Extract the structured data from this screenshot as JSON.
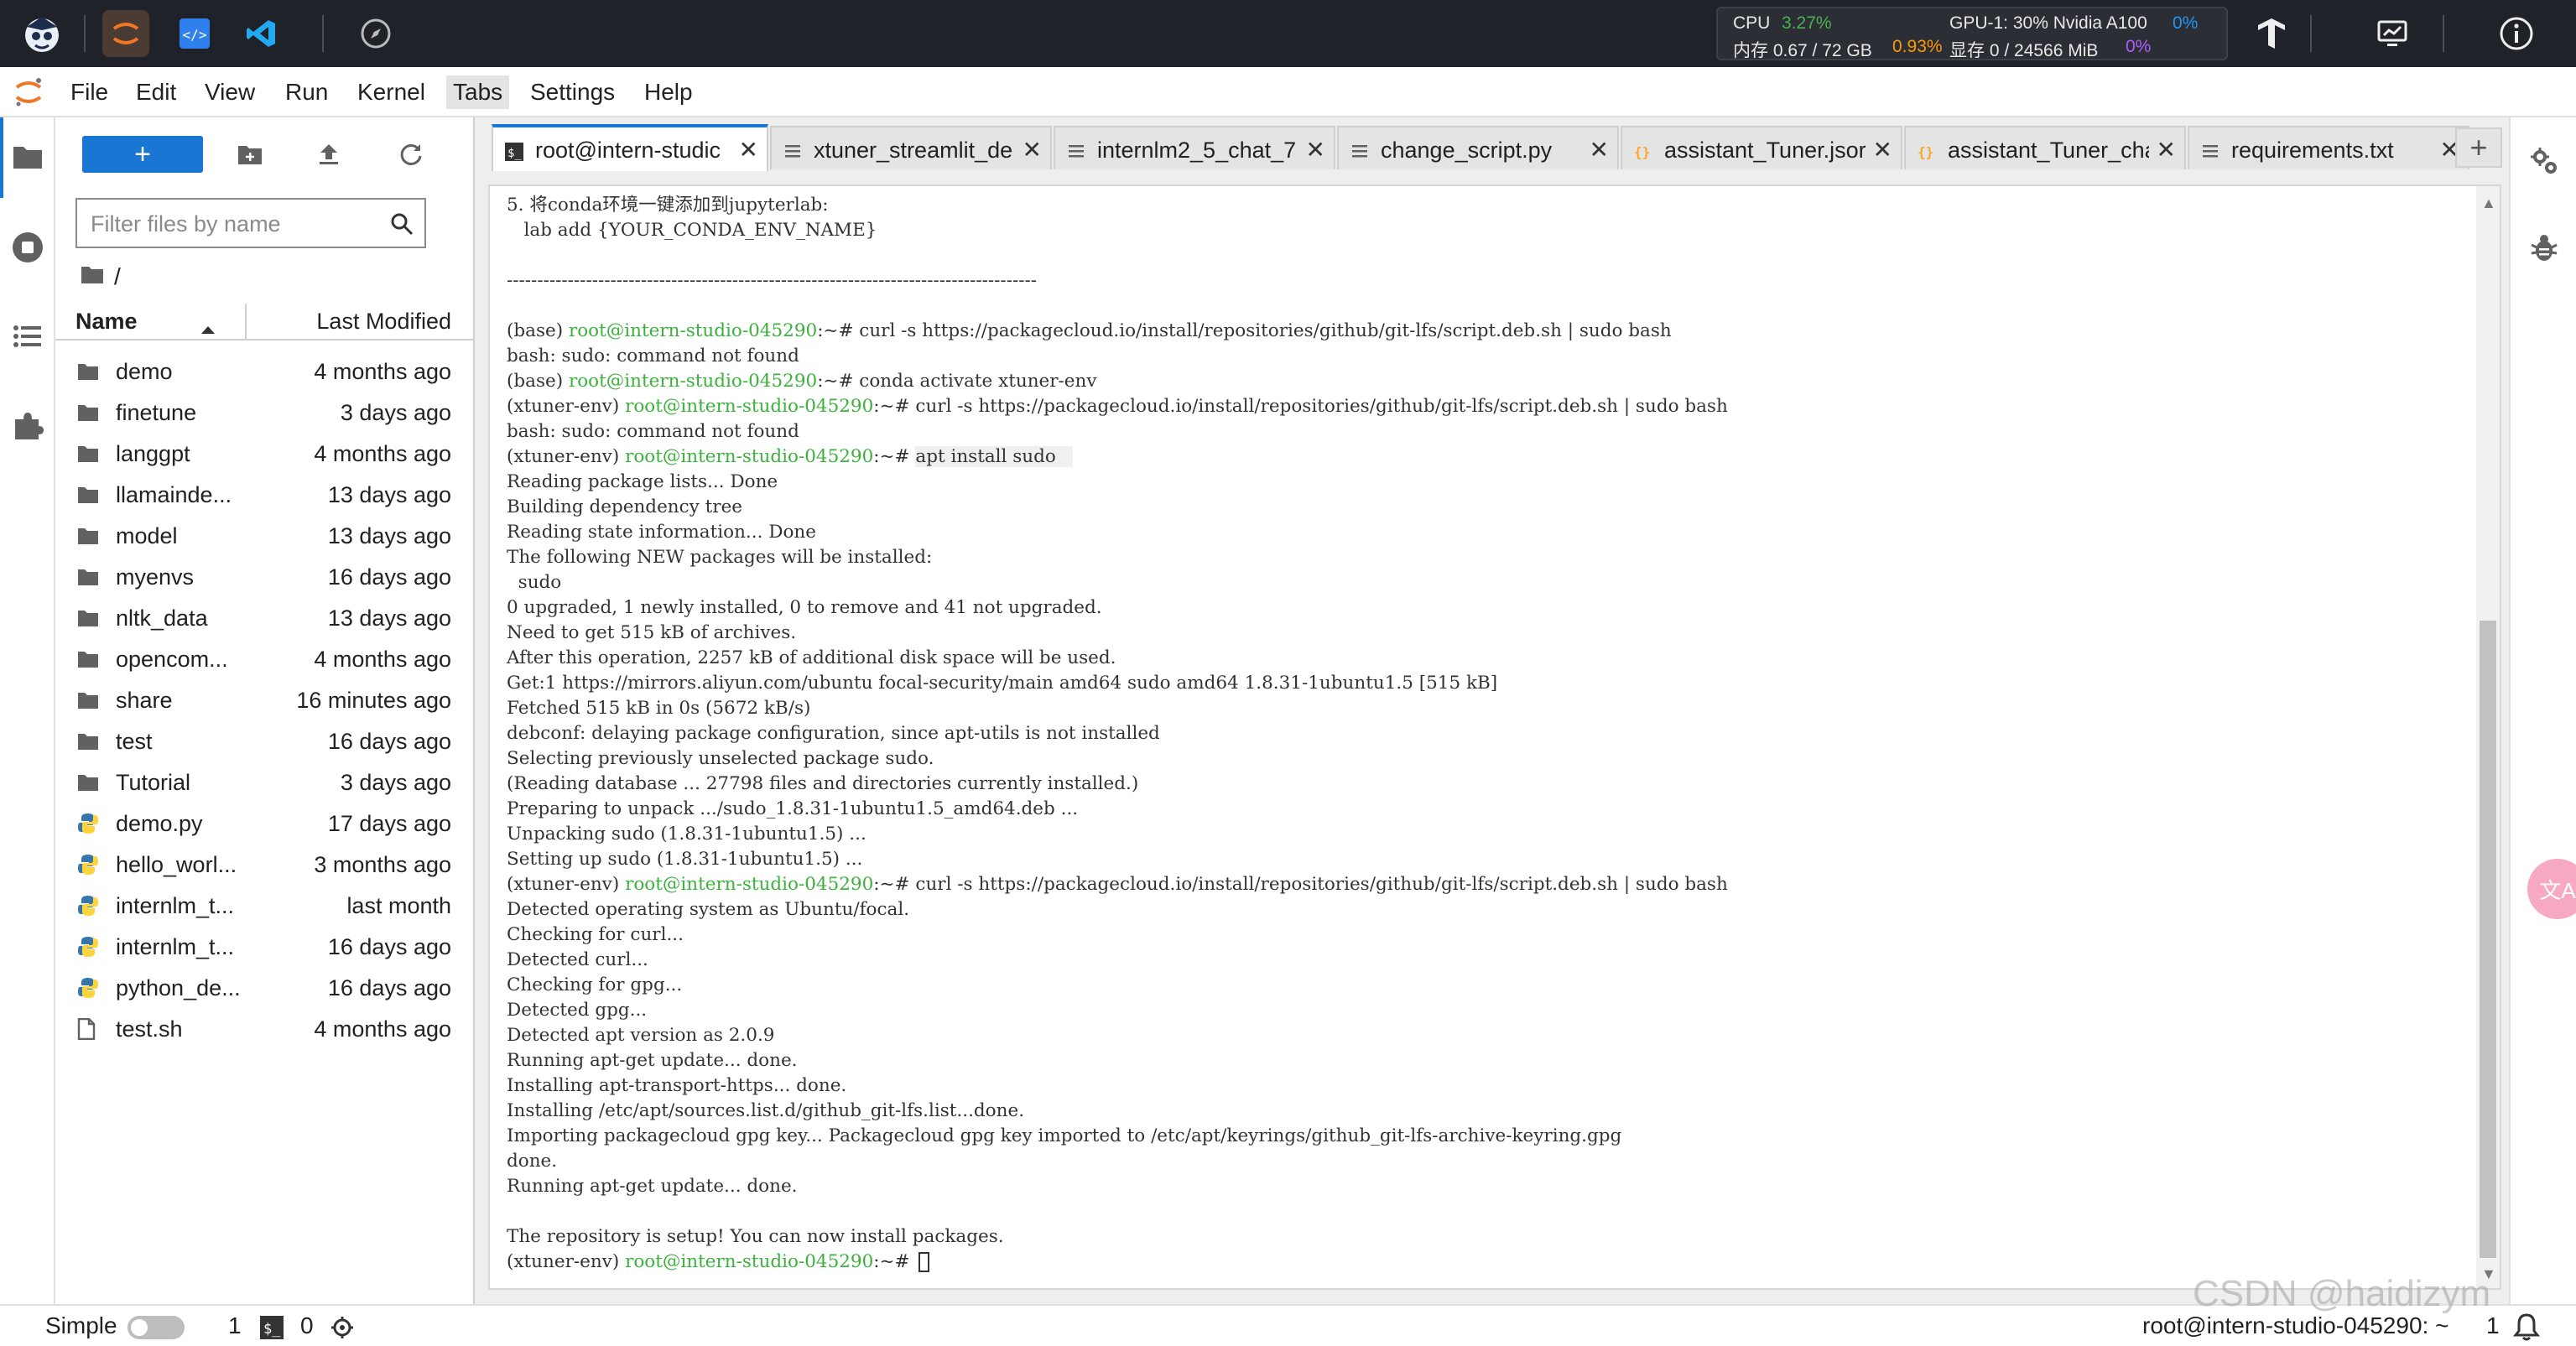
{
  "topbar": {
    "stats": {
      "cpu_label": "CPU",
      "cpu_value": "3.27%",
      "gpu_label": "GPU-1: 30% Nvidia A100",
      "gpu_value": "0%",
      "mem_label": "内存 0.67 / 72 GB",
      "mem_value": "0.93%",
      "vram_label": "显存 0 / 24566 MiB",
      "vram_value": "0%"
    },
    "icons": [
      "intern-logo-icon",
      "jupyter-icon",
      "code-editor-icon",
      "vscode-icon",
      "compass-icon",
      "tensorflow-icon",
      "monitor-icon",
      "info-icon"
    ]
  },
  "menu": [
    "File",
    "Edit",
    "View",
    "Run",
    "Kernel",
    "Tabs",
    "Settings",
    "Help"
  ],
  "menu_active": "Tabs",
  "filebrowser": {
    "new_label": "+",
    "filter_placeholder": "Filter files by name",
    "breadcrumb": "/",
    "col_name": "Name",
    "col_modified": "Last Modified",
    "files": [
      {
        "name": "demo",
        "modified": "4 months ago",
        "type": "folder"
      },
      {
        "name": "finetune",
        "modified": "3 days ago",
        "type": "folder"
      },
      {
        "name": "langgpt",
        "modified": "4 months ago",
        "type": "folder"
      },
      {
        "name": "llamainde...",
        "modified": "13 days ago",
        "type": "folder"
      },
      {
        "name": "model",
        "modified": "13 days ago",
        "type": "folder"
      },
      {
        "name": "myenvs",
        "modified": "16 days ago",
        "type": "folder"
      },
      {
        "name": "nltk_data",
        "modified": "13 days ago",
        "type": "folder"
      },
      {
        "name": "opencom...",
        "modified": "4 months ago",
        "type": "folder"
      },
      {
        "name": "share",
        "modified": "16 minutes ago",
        "type": "folder"
      },
      {
        "name": "test",
        "modified": "16 days ago",
        "type": "folder"
      },
      {
        "name": "Tutorial",
        "modified": "3 days ago",
        "type": "folder"
      },
      {
        "name": "demo.py",
        "modified": "17 days ago",
        "type": "python"
      },
      {
        "name": "hello_worl...",
        "modified": "3 months ago",
        "type": "python"
      },
      {
        "name": "internlm_t...",
        "modified": "last month",
        "type": "python"
      },
      {
        "name": "internlm_t...",
        "modified": "16 days ago",
        "type": "python"
      },
      {
        "name": "python_de...",
        "modified": "16 days ago",
        "type": "python"
      },
      {
        "name": "test.sh",
        "modified": "4 months ago",
        "type": "file"
      }
    ]
  },
  "tabs": [
    {
      "label": "root@intern-studic",
      "type": "terminal",
      "active": true
    },
    {
      "label": "xtuner_streamlit_de",
      "type": "text",
      "active": false
    },
    {
      "label": "internlm2_5_chat_7",
      "type": "text",
      "active": false
    },
    {
      "label": "change_script.py",
      "type": "text",
      "active": false
    },
    {
      "label": "assistant_Tuner.jsor",
      "type": "json",
      "active": false
    },
    {
      "label": "assistant_Tuner_cha",
      "type": "json",
      "active": false
    },
    {
      "label": "requirements.txt",
      "type": "text",
      "active": false
    }
  ],
  "tab_add_label": "+",
  "terminal": {
    "lines": [
      {
        "pre": "5. 将conda环境一键添加到jupyterlab:"
      },
      {
        "pre": "   lab add {YOUR_CONDA_ENV_NAME}"
      },
      {
        "pre": ""
      },
      {
        "pre": "---------------------------------------------------------------------------------------"
      },
      {
        "pre": ""
      },
      {
        "pre": "(base) ",
        "user": "root@intern-studio-045290",
        "post": ":~# curl -s https://packagecloud.io/install/repositories/github/git-lfs/script.deb.sh | sudo bash"
      },
      {
        "pre": "bash: sudo: command not found"
      },
      {
        "pre": "(base) ",
        "user": "root@intern-studio-045290",
        "post": ":~# conda activate xtuner-env"
      },
      {
        "pre": "(xtuner-env) ",
        "user": "root@intern-studio-045290",
        "post": ":~# curl -s https://packagecloud.io/install/repositories/github/git-lfs/script.deb.sh | sudo bash"
      },
      {
        "pre": "bash: sudo: command not found"
      },
      {
        "pre": "(xtuner-env) ",
        "user": "root@intern-studio-045290",
        "post": ":~# ",
        "hl": "apt install sudo   "
      },
      {
        "pre": "Reading package lists... Done"
      },
      {
        "pre": "Building dependency tree"
      },
      {
        "pre": "Reading state information... Done"
      },
      {
        "pre": "The following NEW packages will be installed:"
      },
      {
        "pre": "  sudo"
      },
      {
        "pre": "0 upgraded, 1 newly installed, 0 to remove and 41 not upgraded."
      },
      {
        "pre": "Need to get 515 kB of archives."
      },
      {
        "pre": "After this operation, 2257 kB of additional disk space will be used."
      },
      {
        "pre": "Get:1 https://mirrors.aliyun.com/ubuntu focal-security/main amd64 sudo amd64 1.8.31-1ubuntu1.5 [515 kB]"
      },
      {
        "pre": "Fetched 515 kB in 0s (5672 kB/s)"
      },
      {
        "pre": "debconf: delaying package configuration, since apt-utils is not installed"
      },
      {
        "pre": "Selecting previously unselected package sudo."
      },
      {
        "pre": "(Reading database ... 27798 files and directories currently installed.)"
      },
      {
        "pre": "Preparing to unpack .../sudo_1.8.31-1ubuntu1.5_amd64.deb ..."
      },
      {
        "pre": "Unpacking sudo (1.8.31-1ubuntu1.5) ..."
      },
      {
        "pre": "Setting up sudo (1.8.31-1ubuntu1.5) ..."
      },
      {
        "pre": "(xtuner-env) ",
        "user": "root@intern-studio-045290",
        "post": ":~# curl -s https://packagecloud.io/install/repositories/github/git-lfs/script.deb.sh | sudo bash"
      },
      {
        "pre": "Detected operating system as Ubuntu/focal."
      },
      {
        "pre": "Checking for curl..."
      },
      {
        "pre": "Detected curl..."
      },
      {
        "pre": "Checking for gpg..."
      },
      {
        "pre": "Detected gpg..."
      },
      {
        "pre": "Detected apt version as 2.0.9"
      },
      {
        "pre": "Running apt-get update... done."
      },
      {
        "pre": "Installing apt-transport-https... done."
      },
      {
        "pre": "Installing /etc/apt/sources.list.d/github_git-lfs.list...done."
      },
      {
        "pre": "Importing packagecloud gpg key... Packagecloud gpg key imported to /etc/apt/keyrings/github_git-lfs-archive-keyring.gpg"
      },
      {
        "pre": "done."
      },
      {
        "pre": "Running apt-get update... done."
      },
      {
        "pre": ""
      },
      {
        "pre": "The repository is setup! You can now install packages."
      },
      {
        "pre": "(xtuner-env) ",
        "user": "root@intern-studio-045290",
        "post": ":~# ",
        "cursor": true
      }
    ]
  },
  "statusbar": {
    "mode_label": "Simple",
    "count1": "1",
    "count2": "0",
    "terminal_label": "root@intern-studio-045290: ~",
    "notif_count": "1"
  },
  "watermark": "CSDN @haidizym",
  "translate_label": "文A",
  "colors": {
    "accent": "#1976d2",
    "prompt_green": "#3bb23b",
    "topbar_bg": "#1f2228",
    "stat_green": "#4caf50",
    "stat_orange": "#ff9800",
    "stat_blue": "#2196f3"
  }
}
